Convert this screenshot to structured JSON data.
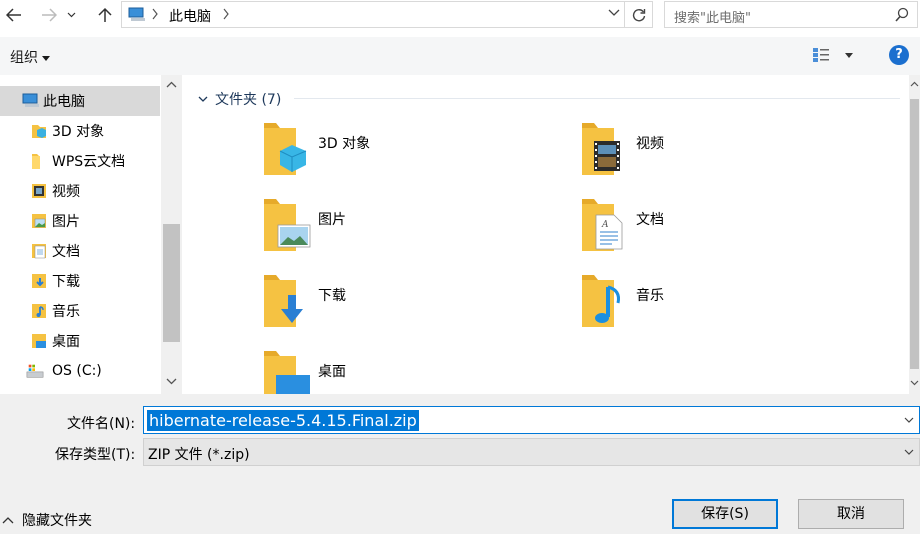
{
  "address": {
    "location": "此电脑",
    "search_placeholder": "搜索\"此电脑\""
  },
  "toolbar": {
    "organize_label": "组织",
    "help_glyph": "?"
  },
  "nav": {
    "items": [
      {
        "label": "此电脑",
        "icon": "computer-icon",
        "selected": true
      },
      {
        "label": "3D 对象",
        "icon": "3d-objects-icon"
      },
      {
        "label": "WPS云文档",
        "icon": "folder-icon"
      },
      {
        "label": "视频",
        "icon": "video-icon"
      },
      {
        "label": "图片",
        "icon": "pictures-icon"
      },
      {
        "label": "文档",
        "icon": "documents-icon"
      },
      {
        "label": "下载",
        "icon": "downloads-icon"
      },
      {
        "label": "音乐",
        "icon": "music-icon"
      },
      {
        "label": "桌面",
        "icon": "desktop-icon"
      },
      {
        "label": "OS (C:)",
        "icon": "drive-icon"
      }
    ]
  },
  "content": {
    "group_title": "文件夹 (7)",
    "folders": [
      {
        "label": "3D 对象",
        "icon": "3d-objects-folder-icon"
      },
      {
        "label": "视频",
        "icon": "video-folder-icon"
      },
      {
        "label": "图片",
        "icon": "pictures-folder-icon"
      },
      {
        "label": "文档",
        "icon": "documents-folder-icon"
      },
      {
        "label": "下载",
        "icon": "downloads-folder-icon"
      },
      {
        "label": "音乐",
        "icon": "music-folder-icon"
      },
      {
        "label": "桌面",
        "icon": "desktop-folder-icon"
      }
    ]
  },
  "form": {
    "filename_label": "文件名(N):",
    "filename_value": "hibernate-release-5.4.15.Final.zip",
    "filetype_label": "保存类型(T):",
    "filetype_value": "ZIP 文件 (*.zip)",
    "hide_folders_label": "隐藏文件夹",
    "save_label": "保存(S)",
    "cancel_label": "取消"
  },
  "colors": {
    "accent": "#0078d7",
    "folder": "#f5c242",
    "selection_bg": "#d9d9d9"
  }
}
